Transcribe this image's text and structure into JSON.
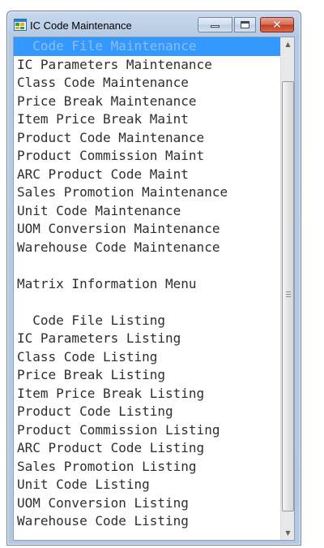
{
  "window": {
    "title": "IC Code Maintenance",
    "icon": "ic-app-icon",
    "controls": {
      "minimize": "minimize-icon",
      "maximize": "maximize-icon",
      "close": "close-icon"
    }
  },
  "menu": {
    "selected_index": 0,
    "items": [
      "  Code File Maintenance",
      "IC Parameters Maintenance",
      "Class Code Maintenance",
      "Price Break Maintenance",
      "Item Price Break Maint",
      "Product Code Maintenance",
      "Product Commission Maint",
      "ARC Product Code Maint",
      "Sales Promotion Maintenance",
      "Unit Code Maintenance",
      "UOM Conversion Maintenance",
      "Warehouse Code Maintenance",
      "",
      "Matrix Information Menu",
      "",
      "  Code File Listing",
      "IC Parameters Listing",
      "Class Code Listing",
      "Price Break Listing",
      "Item Price Break Listing",
      "Product Code Listing",
      "Product Commission Listing",
      "ARC Product Code Listing",
      "Sales Promotion Listing",
      "Unit Code Listing",
      "UOM Conversion Listing",
      "Warehouse Code Listing"
    ]
  },
  "colors": {
    "selection": "#3399ff",
    "close_button": "#c23c20",
    "list_text": "#2e2e2e"
  }
}
